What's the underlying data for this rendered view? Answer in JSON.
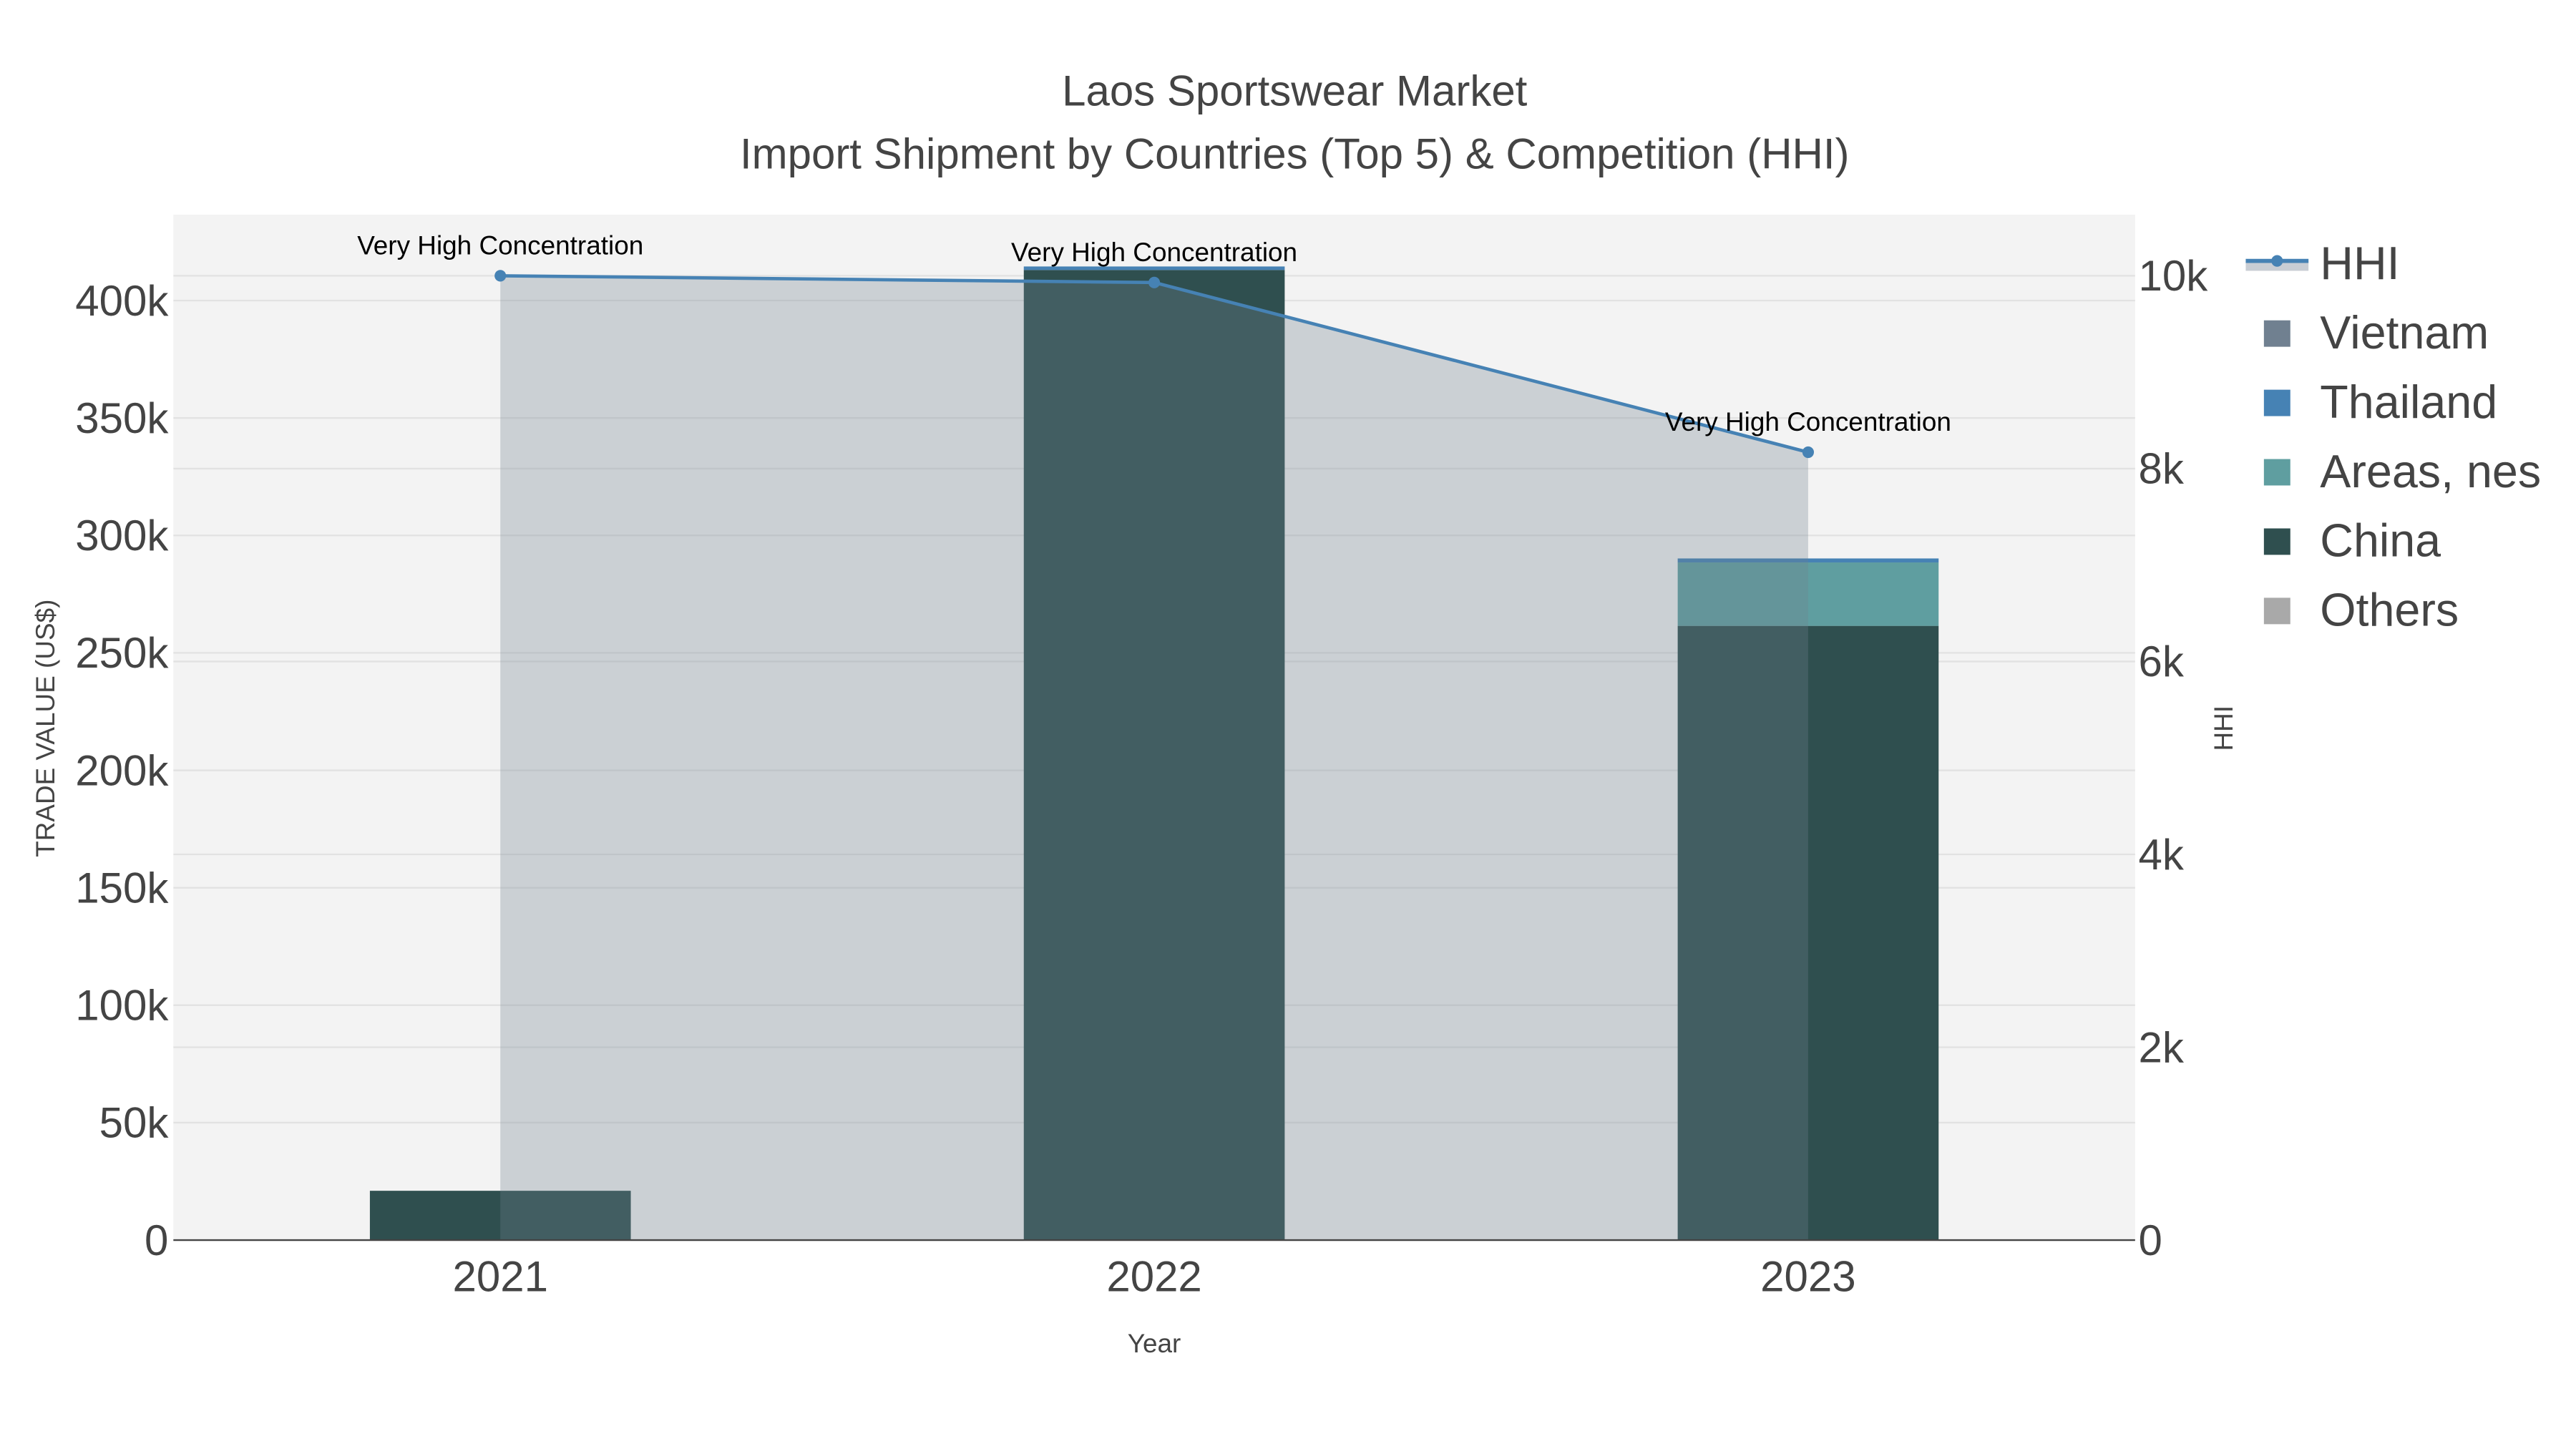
{
  "chart_data": {
    "type": "bar",
    "title": "Laos Sportswear Market",
    "subtitle": "Import Shipment by Countries (Top 5) & Competition (HHI)",
    "xlabel": "Year",
    "ylabel": "TRADE VALUE (US$)",
    "y2label": "HHI",
    "categories": [
      "2021",
      "2022",
      "2023"
    ],
    "ylim": [
      0,
      435000
    ],
    "y2lim": [
      0,
      10600
    ],
    "yticks": [
      0,
      50000,
      100000,
      150000,
      200000,
      250000,
      300000,
      350000,
      400000
    ],
    "ytick_labels": [
      "0",
      "50k",
      "100k",
      "150k",
      "200k",
      "250k",
      "300k",
      "350k",
      "400k"
    ],
    "y2ticks": [
      0,
      2000,
      4000,
      6000,
      8000,
      10000
    ],
    "y2tick_labels": [
      "0",
      "2k",
      "4k",
      "6k",
      "8k",
      "10k"
    ],
    "barmode": "stack",
    "series": [
      {
        "name": "China",
        "color": "#2f4f4f",
        "values": [
          21000,
          413000,
          261500
        ]
      },
      {
        "name": "Areas, nes",
        "color": "#5f9ea0",
        "values": [
          0,
          0,
          27000
        ]
      },
      {
        "name": "Thailand",
        "color": "#4682b4",
        "values": [
          0,
          1500,
          1700
        ]
      },
      {
        "name": "Vietnam",
        "color": "#708090",
        "values": [
          0,
          0,
          0
        ]
      },
      {
        "name": "Others",
        "color": "#a9a9a9",
        "values": [
          0,
          0,
          0
        ]
      }
    ],
    "hhi": {
      "name": "HHI",
      "color": "#4682b4",
      "values": [
        10000,
        9930,
        8170
      ],
      "annotations": [
        "Very High Concentration",
        "Very High Concentration",
        "Very High Concentration"
      ]
    },
    "legend": {
      "placement": "top-right",
      "entries": [
        "HHI",
        "Vietnam",
        "Thailand",
        "Areas, nes",
        "China",
        "Others"
      ]
    },
    "grid": true
  }
}
